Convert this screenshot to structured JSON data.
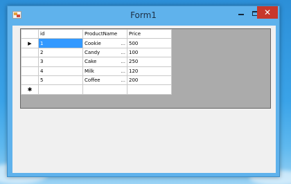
{
  "window": {
    "title": "Form1",
    "close_glyph": "✕"
  },
  "grid": {
    "columns": [
      "id",
      "ProductName",
      "Price"
    ],
    "rows": [
      {
        "id": "1",
        "name": "Cookie",
        "price": "500"
      },
      {
        "id": "2",
        "name": "Candy",
        "price": "100"
      },
      {
        "id": "3",
        "name": "Cake",
        "price": "250"
      },
      {
        "id": "4",
        "name": "Milk",
        "price": "120"
      },
      {
        "id": "5",
        "name": "Coffee",
        "price": "200"
      }
    ],
    "ellipsis": "...",
    "current_row_glyph": "▶",
    "new_row_glyph": "✱"
  },
  "colors": {
    "selection": "#3399ff",
    "close_button": "#c7382b",
    "grid_background": "#ababab"
  },
  "icons": [
    "app-icon",
    "minimize-icon",
    "maximize-icon",
    "close-icon",
    "current-row-icon",
    "new-row-icon"
  ]
}
